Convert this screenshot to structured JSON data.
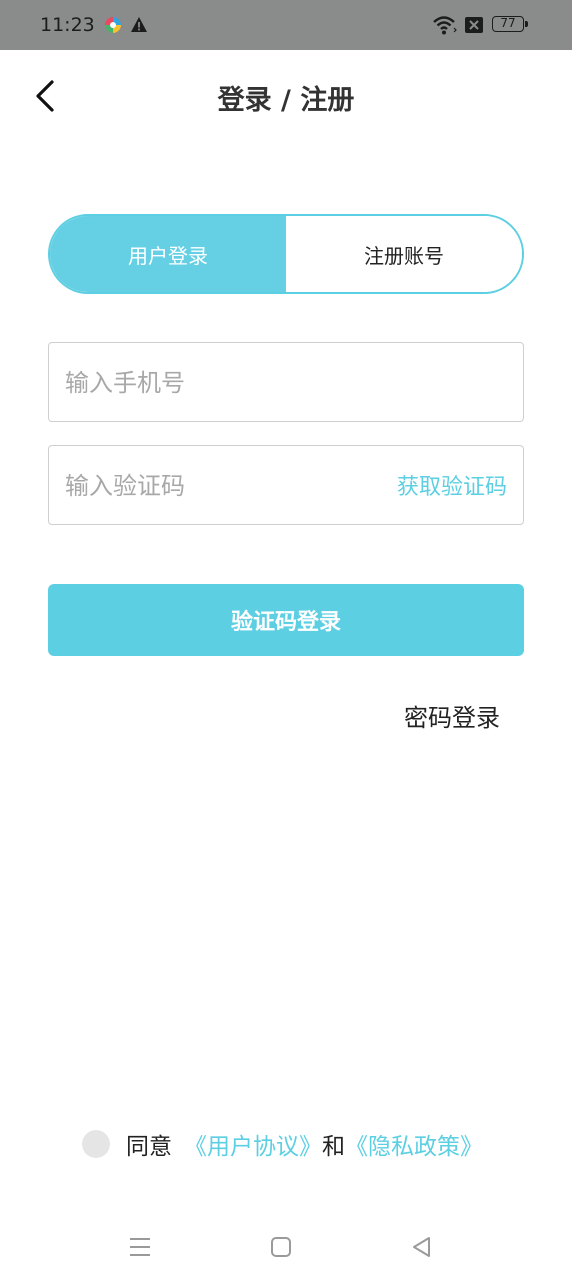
{
  "status_bar": {
    "time": "11:23",
    "battery": "77",
    "icons": [
      "app-notification-icon",
      "alert-icon",
      "wifi-icon",
      "sim-off-icon",
      "battery-icon"
    ]
  },
  "header": {
    "title": "登录 / 注册",
    "back_icon": "back-icon"
  },
  "tabs": {
    "login": "用户登录",
    "register": "注册账号",
    "active": "login"
  },
  "form": {
    "phone_placeholder": "输入手机号",
    "phone_value": "",
    "code_placeholder": "输入验证码",
    "code_value": "",
    "get_code": "获取验证码",
    "submit": "验证码登录",
    "password_login": "密码登录"
  },
  "agreement": {
    "checked": false,
    "prefix": "同意",
    "user_agreement": "《用户协议》",
    "and": "和",
    "privacy_policy": "《隐私政策》"
  },
  "colors": {
    "accent": "#5CCFE2",
    "status_bar_bg": "#8A8C8C",
    "text": "#222222",
    "placeholder": "#A8A8A8",
    "radio_bg": "#E5E5E5"
  },
  "nav_bar": {
    "icons": [
      "menu-icon",
      "home-icon",
      "back-triangle-icon"
    ]
  }
}
